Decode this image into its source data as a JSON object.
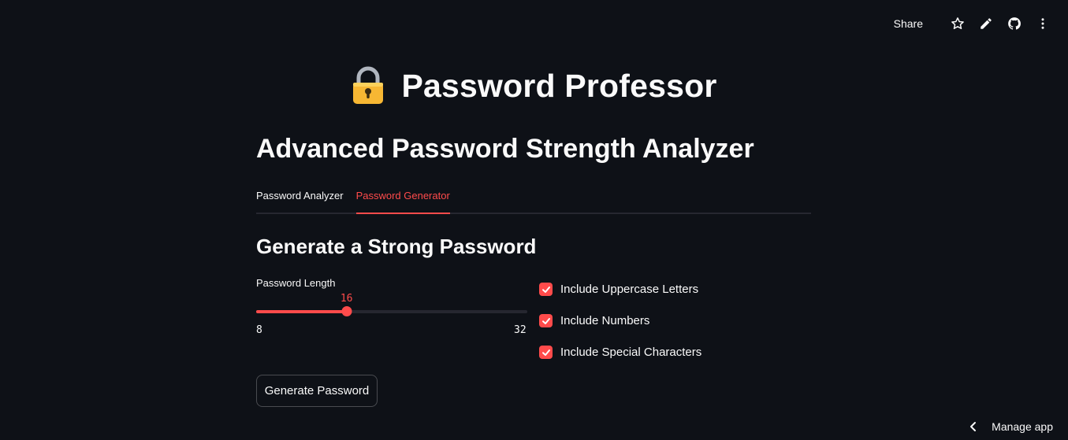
{
  "toolbar": {
    "share_label": "Share",
    "icons": [
      "star-icon",
      "pencil-icon",
      "github-icon",
      "more-vertical-icon"
    ]
  },
  "header": {
    "title": "Password Professor",
    "title_icon": "lock-icon"
  },
  "main": {
    "subtitle": "Advanced Password Strength Analyzer",
    "tabs": [
      {
        "label": "Password Analyzer",
        "active": false
      },
      {
        "label": "Password Generator",
        "active": true
      }
    ],
    "section_heading": "Generate a Strong Password",
    "slider": {
      "label": "Password Length",
      "value": "16",
      "min": "8",
      "max": "32"
    },
    "checkboxes": [
      {
        "label": "Include Uppercase Letters",
        "checked": true
      },
      {
        "label": "Include Numbers",
        "checked": true
      },
      {
        "label": "Include Special Characters",
        "checked": true
      }
    ],
    "generate_button_label": "Generate Password"
  },
  "footer": {
    "manage_app_label": "Manage app"
  },
  "colors": {
    "background": "#0e1117",
    "accent": "#ff4b4b",
    "text": "#fafafa",
    "track": "#262730"
  }
}
